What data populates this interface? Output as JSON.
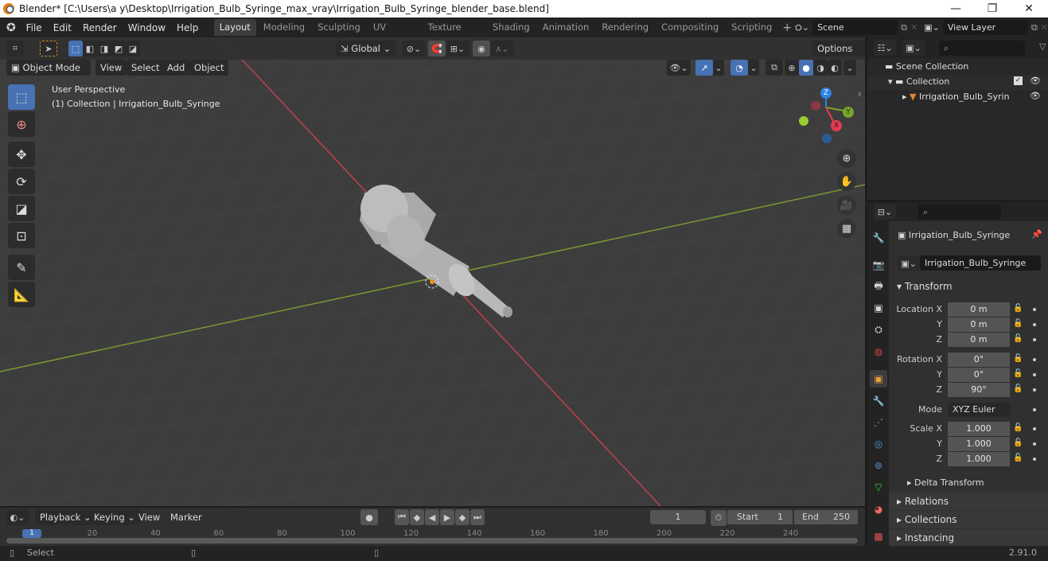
{
  "window": {
    "title": "Blender* [C:\\Users\\a y\\Desktop\\Irrigation_Bulb_Syringe_max_vray\\Irrigation_Bulb_Syringe_blender_base.blend]",
    "minimize": "—",
    "maximize": "❐",
    "close": "✕"
  },
  "menu": [
    "File",
    "Edit",
    "Render",
    "Window",
    "Help"
  ],
  "workspaces": [
    "Layout",
    "Modeling",
    "Sculpting",
    "UV Editing",
    "Texture Paint",
    "Shading",
    "Animation",
    "Rendering",
    "Compositing",
    "Scripting"
  ],
  "active_workspace": "Layout",
  "add_workspace": "+",
  "scene": {
    "name": "Scene"
  },
  "view_layer": {
    "name": "View Layer"
  },
  "viewport": {
    "mode": "Object Mode",
    "header_menus": [
      "View",
      "Select",
      "Add",
      "Object"
    ],
    "transform_orientation": "Global",
    "options_label": "Options",
    "overlay_text_1": "User Perspective",
    "overlay_text_2": "(1) Collection | Irrigation_Bulb_Syringe",
    "gizmo": {
      "x": "X",
      "y": "Y",
      "z": "Z"
    },
    "colors": {
      "x_axis": "#c1404f",
      "y_axis": "#7a9a2e",
      "gizmo_z": "#2f82e6",
      "gizmo_y": "#76a52a",
      "gizmo_x": "#e63a50"
    }
  },
  "outliner": {
    "search_placeholder": "",
    "items": [
      {
        "label": "Scene Collection",
        "level": 0
      },
      {
        "label": "Collection",
        "level": 1
      },
      {
        "label": "Irrigation_Bulb_Syrin",
        "level": 2
      }
    ]
  },
  "properties": {
    "search_placeholder": "",
    "object_name": "Irrigation_Bulb_Syringe",
    "object_field": "Irrigation_Bulb_Syringe",
    "transform_label": "Transform",
    "location_label": "Location X",
    "rotation_label": "Rotation X",
    "scale_label": "Scale X",
    "y_label": "Y",
    "z_label": "Z",
    "location": [
      "0 m",
      "0 m",
      "0 m"
    ],
    "rotation": [
      "0°",
      "0°",
      "90°"
    ],
    "mode_label": "Mode",
    "mode_value": "XYZ Euler",
    "scale": [
      "1.000",
      "1.000",
      "1.000"
    ],
    "panels": {
      "delta": "Delta Transform",
      "relations": "Relations",
      "collections": "Collections",
      "instancing": "Instancing"
    }
  },
  "timeline": {
    "menus": [
      "Playback",
      "Keying",
      "View",
      "Marker"
    ],
    "current_frame": "1",
    "start_label": "Start",
    "start_value": "1",
    "end_label": "End",
    "end_value": "250",
    "ruler": [
      "1",
      "20",
      "40",
      "60",
      "80",
      "100",
      "120",
      "140",
      "160",
      "180",
      "200",
      "220",
      "240"
    ]
  },
  "statusbar": {
    "select_label": "Select",
    "version": "2.91.0"
  }
}
